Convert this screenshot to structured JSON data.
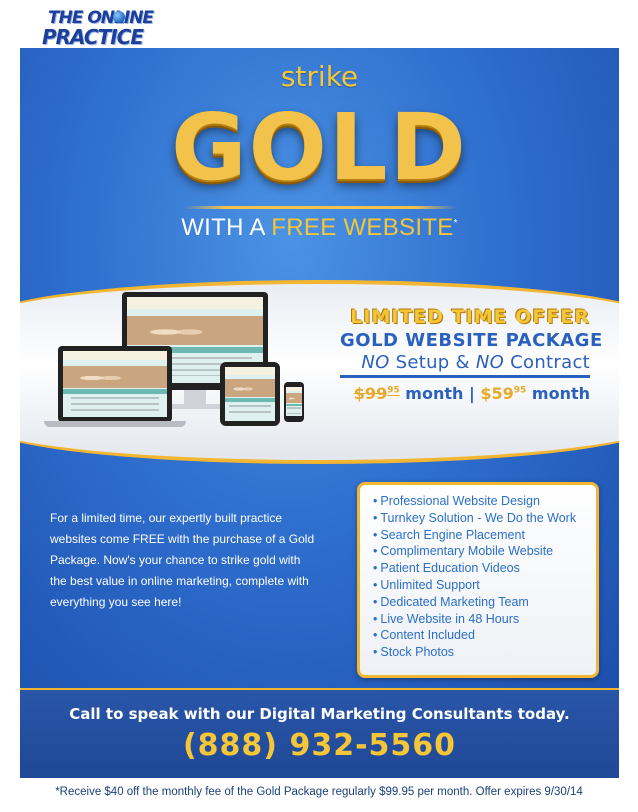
{
  "logo": {
    "line1": "THE ONLINE",
    "line2": "PRACTICE"
  },
  "hero": {
    "strike": "strike",
    "gold": "GOLD",
    "tagline_prefix": "WITH A ",
    "tagline_highlight": "FREE WEBSITE",
    "tagline_mark": "*"
  },
  "offer": {
    "line1": "LIMITED TIME OFFER",
    "line2": "GOLD WEBSITE PACKAGE",
    "no1": "NO",
    "setup": " Setup & ",
    "no2": "NO",
    "contract": " Contract",
    "old_price": "$99",
    "old_cents": "95",
    "per1": " month | ",
    "new_price": "$59",
    "new_cents": "95",
    "per2": " month"
  },
  "blurb": "For a limited time, our expertly built practice websites come FREE with the purchase of a Gold Package. Now's your chance to strike gold with the best value in online marketing, complete with everything you see here!",
  "features": [
    "Professional Website Design",
    "Turnkey Solution - We Do the Work",
    "Search Engine Placement",
    "Complimentary Mobile Website",
    "Patient Education Videos",
    "Unlimited Support",
    "Dedicated Marketing Team",
    "Live Website in 48 Hours",
    "Content Included",
    "Stock Photos"
  ],
  "cta": {
    "line1": "Call to speak with our Digital Marketing Consultants today.",
    "phone": "(888) 932-5560"
  },
  "footnote": "*Receive $40 off the monthly fee of the Gold Package regularly $99.95 per month. Offer expires 9/30/14"
}
